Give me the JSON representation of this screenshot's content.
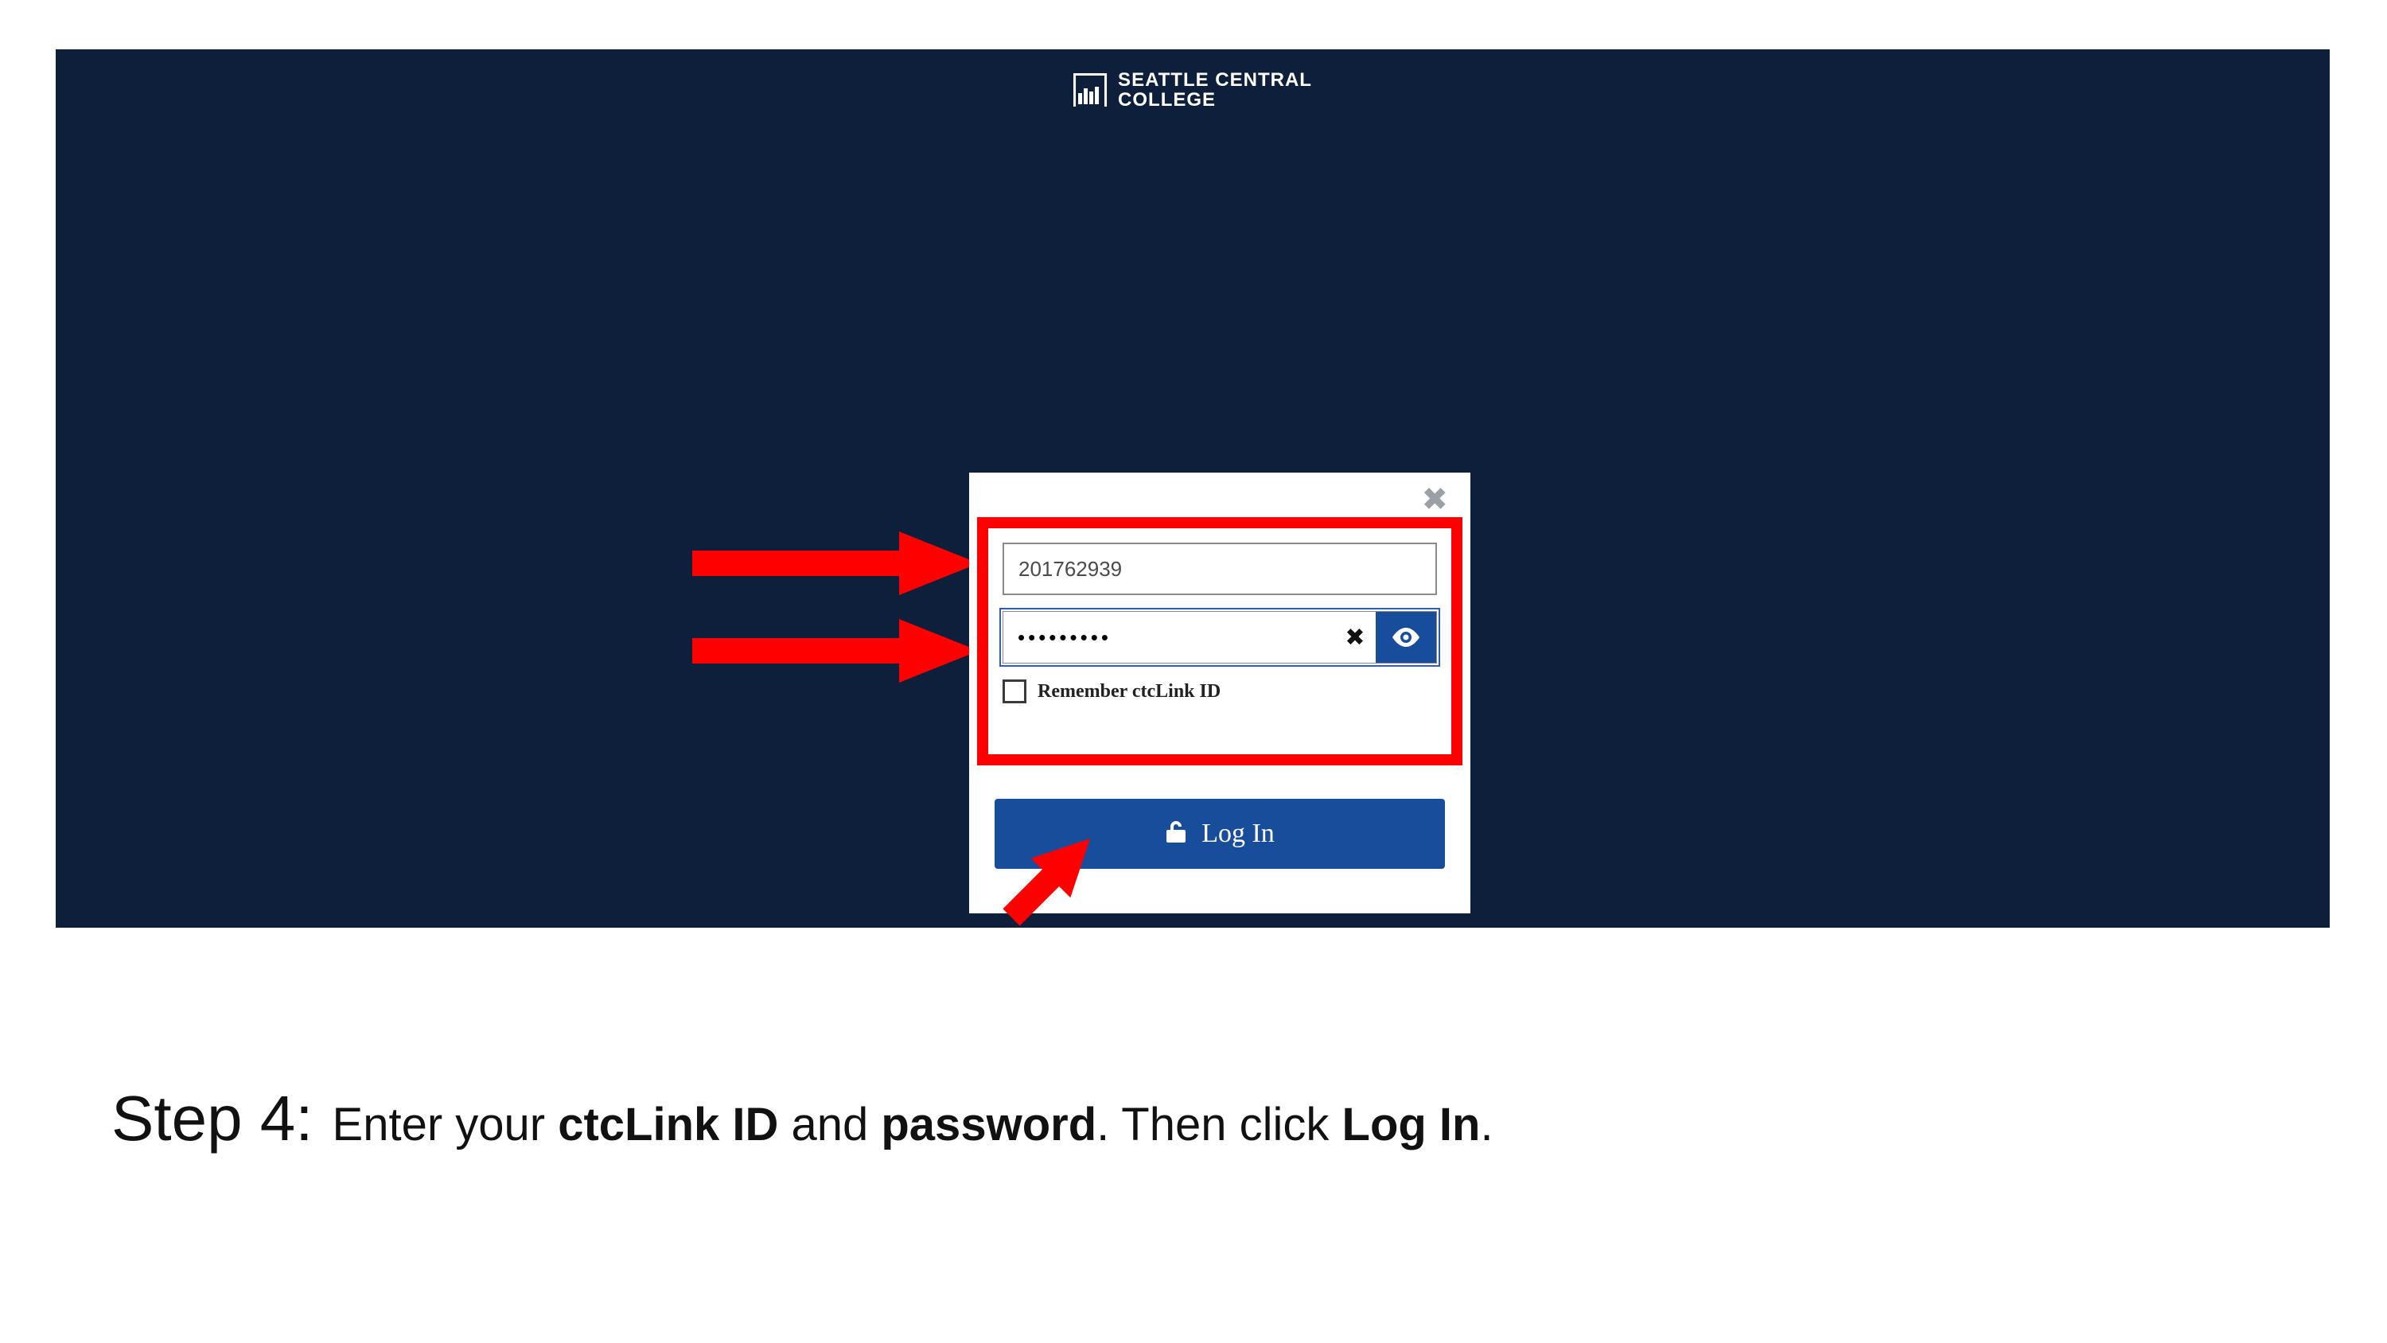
{
  "brand": {
    "line1": "SEATTLE CENTRAL",
    "line2": "COLLEGE"
  },
  "login": {
    "id_value": "201762939",
    "password_mask": "•••••••••",
    "remember_label": "Remember ctcLink ID",
    "login_button": "Log In"
  },
  "instruction": {
    "step_label": "Step 4:",
    "p1": "Enter your ",
    "b1": "ctcLink ID",
    "p2": " and ",
    "b2": "password",
    "p3": ".  Then click ",
    "b3": "Log In",
    "p4": "."
  }
}
